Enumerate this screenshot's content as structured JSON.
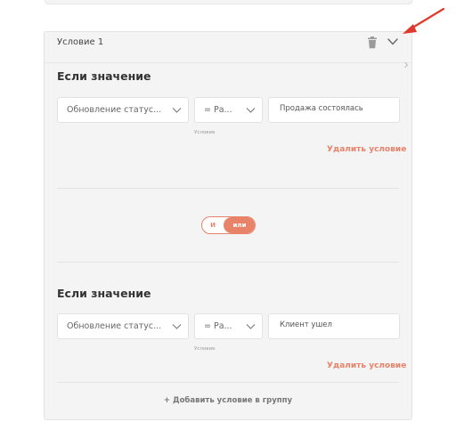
{
  "condition": {
    "title": "Условие 1",
    "groups": [
      {
        "heading": "Если значение",
        "field_select": "Обновление статус...",
        "operator_select": "= Ра...",
        "operator_hint": "Условие",
        "value": "Продажа состоялась",
        "delete_label": "Удалить условие"
      },
      {
        "heading": "Если значение",
        "field_select": "Обновление статус...",
        "operator_select": "= Ра...",
        "operator_hint": "Условие",
        "value": "Клиент ушел",
        "delete_label": "Удалить условие"
      }
    ],
    "toggle": {
      "and_label": "И",
      "or_label": "или",
      "selected": "или"
    },
    "add_label": "+ Добавить условие в группу"
  },
  "colors": {
    "accent": "#e8836a",
    "arrow": "#e03a2e",
    "panel_bg": "#f4f4f4"
  },
  "icons": {
    "delete": "trash-icon",
    "collapse": "chevron-down-icon"
  }
}
